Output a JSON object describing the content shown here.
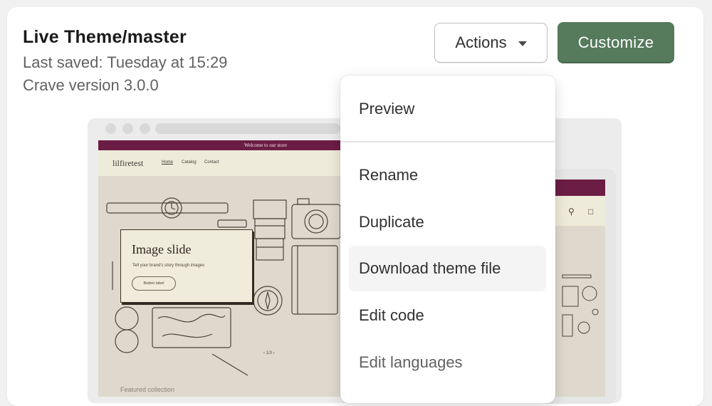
{
  "theme": {
    "title": "Live Theme/master",
    "last_saved": "Last saved: Tuesday at 15:29",
    "version": "Crave version 3.0.0"
  },
  "header_buttons": {
    "actions_label": "Actions",
    "customize_label": "Customize"
  },
  "colors": {
    "primary_button": "#557a5c",
    "site_accent": "#6b1d45"
  },
  "actions_menu": {
    "items": [
      {
        "label": "Preview"
      },
      {
        "label": "Rename"
      },
      {
        "label": "Duplicate"
      },
      {
        "label": "Download theme file",
        "state": "hovered"
      },
      {
        "label": "Edit code"
      },
      {
        "label": "Edit languages"
      }
    ]
  },
  "preview": {
    "announcement": "Welcome to our store",
    "store_name": "lilfiretest",
    "nav": [
      "Home",
      "Catalog",
      "Contact"
    ],
    "slide_heading": "Image slide",
    "slide_subtext": "Tell your brand's story through images",
    "slide_button": "Button label",
    "slide_pager": "‹   1/3   ›",
    "featured_label": "Featured collection"
  }
}
